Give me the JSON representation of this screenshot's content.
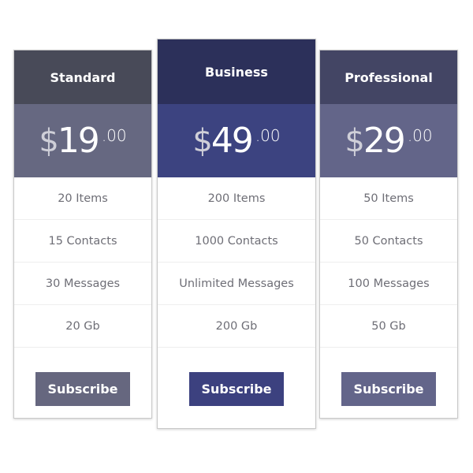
{
  "plans": [
    {
      "name": "Standard",
      "currency": "$",
      "amount": "19",
      "cents": ".00",
      "features": [
        "20 Items",
        "15 Contacts",
        "30 Messages",
        "20 Gb"
      ],
      "button_label": "Subscribe",
      "colors": {
        "header": "#484a58",
        "price": "#666881",
        "button": "#66677f"
      }
    },
    {
      "name": "Business",
      "currency": "$",
      "amount": "49",
      "cents": ".00",
      "features": [
        "200 Items",
        "1000 Contacts",
        "Unlimited Messages",
        "200 Gb"
      ],
      "button_label": "Subscribe",
      "colors": {
        "header": "#2c305a",
        "price": "#3c4380",
        "button": "#3c417f"
      }
    },
    {
      "name": "Professional",
      "currency": "$",
      "amount": "29",
      "cents": ".00",
      "features": [
        "50 Items",
        "50 Contacts",
        "100 Messages",
        "50 Gb"
      ],
      "button_label": "Subscribe",
      "colors": {
        "header": "#434564",
        "price": "#636589",
        "button": "#63658a"
      }
    }
  ]
}
